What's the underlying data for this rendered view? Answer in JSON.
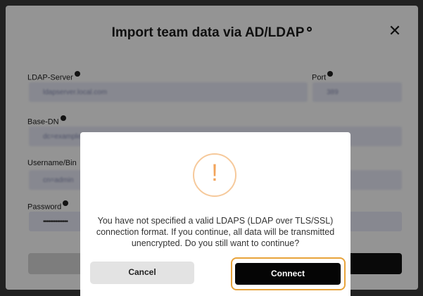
{
  "modal": {
    "title": "Import team data via AD/LDAP",
    "close_label": "✕",
    "fields": {
      "ldap_server": {
        "label": "LDAP-Server",
        "value": "ldapserver.local.com"
      },
      "port": {
        "label": "Port",
        "value": "389"
      },
      "base_dn": {
        "label": "Base-DN",
        "value": "dc=example,dc=com,ou=users,cn=admin,dc=local"
      },
      "username": {
        "label": "Username/Bin",
        "value": "cn=admin"
      },
      "password": {
        "label": "Password",
        "value": "••••••••••••••"
      }
    }
  },
  "dialog": {
    "icon": "!",
    "message": "You have not specified a valid LDAPS (LDAP over TLS/SSL) connection format. If you continue, all data will be transmitted unencrypted. Do you still want to continue?",
    "cancel_label": "Cancel",
    "connect_label": "Connect"
  },
  "colors": {
    "accent_focus": "#e8a33a",
    "warning_icon": "#f2a35a",
    "input_bg": "#e9ebf8"
  }
}
